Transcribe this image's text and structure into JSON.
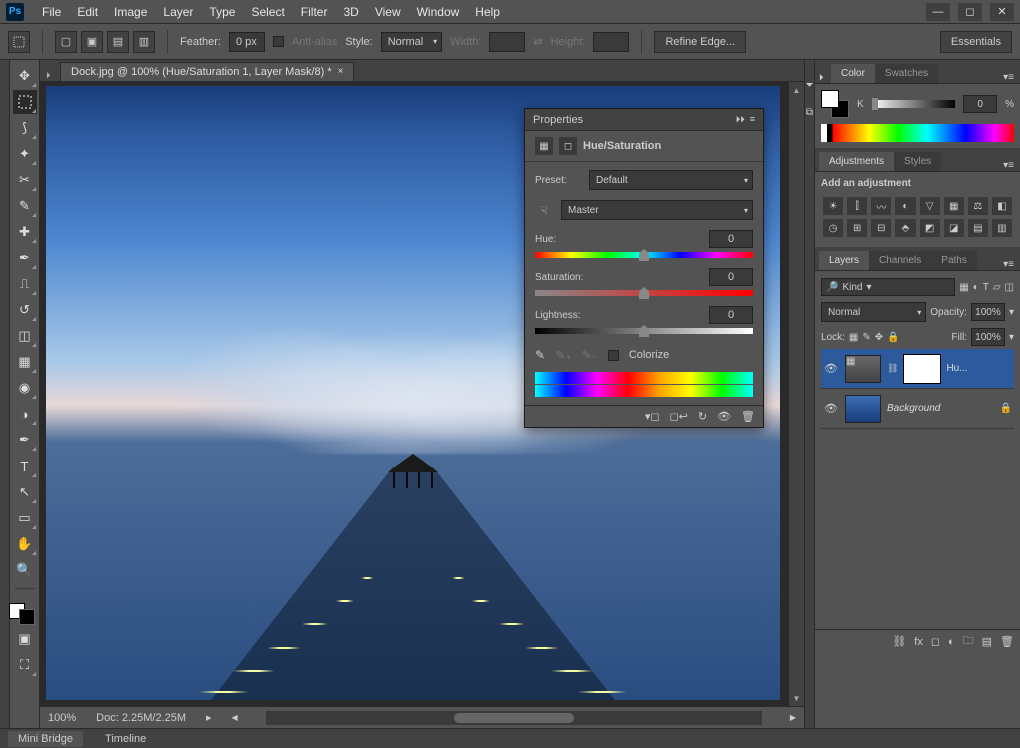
{
  "menubar": [
    "File",
    "Edit",
    "Image",
    "Layer",
    "Type",
    "Select",
    "Filter",
    "3D",
    "View",
    "Window",
    "Help"
  ],
  "options": {
    "feather_label": "Feather:",
    "feather_value": "0 px",
    "antialias_label": "Anti-alias",
    "style_label": "Style:",
    "style_value": "Normal",
    "width_label": "Width:",
    "height_label": "Height:",
    "refine_label": "Refine Edge...",
    "workspace": "Essentials"
  },
  "document": {
    "tab_title": "Dock.jpg @ 100% (Hue/Saturation 1, Layer Mask/8) *",
    "zoom": "100%",
    "doc_info": "Doc: 2.25M/2.25M"
  },
  "color_panel": {
    "tabs": [
      "Color",
      "Swatches"
    ],
    "channel": "K",
    "value": "0",
    "unit": "%"
  },
  "adjustments_panel": {
    "tabs": [
      "Adjustments",
      "Styles"
    ],
    "heading": "Add an adjustment"
  },
  "layers_panel": {
    "tabs": [
      "Layers",
      "Channels",
      "Paths"
    ],
    "filter": "Kind",
    "blend_mode": "Normal",
    "opacity_label": "Opacity:",
    "opacity_value": "100%",
    "lock_label": "Lock:",
    "fill_label": "Fill:",
    "fill_value": "100%",
    "layers": [
      {
        "name": "Hu...",
        "type": "adjustment",
        "visible": true,
        "selected": true
      },
      {
        "name": "Background",
        "type": "image",
        "visible": true,
        "locked": true
      }
    ]
  },
  "properties": {
    "title": "Properties",
    "adj_name": "Hue/Saturation",
    "preset_label": "Preset:",
    "preset_value": "Default",
    "channel_value": "Master",
    "hue_label": "Hue:",
    "hue_value": "0",
    "saturation_label": "Saturation:",
    "saturation_value": "0",
    "lightness_label": "Lightness:",
    "lightness_value": "0",
    "colorize_label": "Colorize"
  },
  "bottom_tabs": [
    "Mini Bridge",
    "Timeline"
  ]
}
